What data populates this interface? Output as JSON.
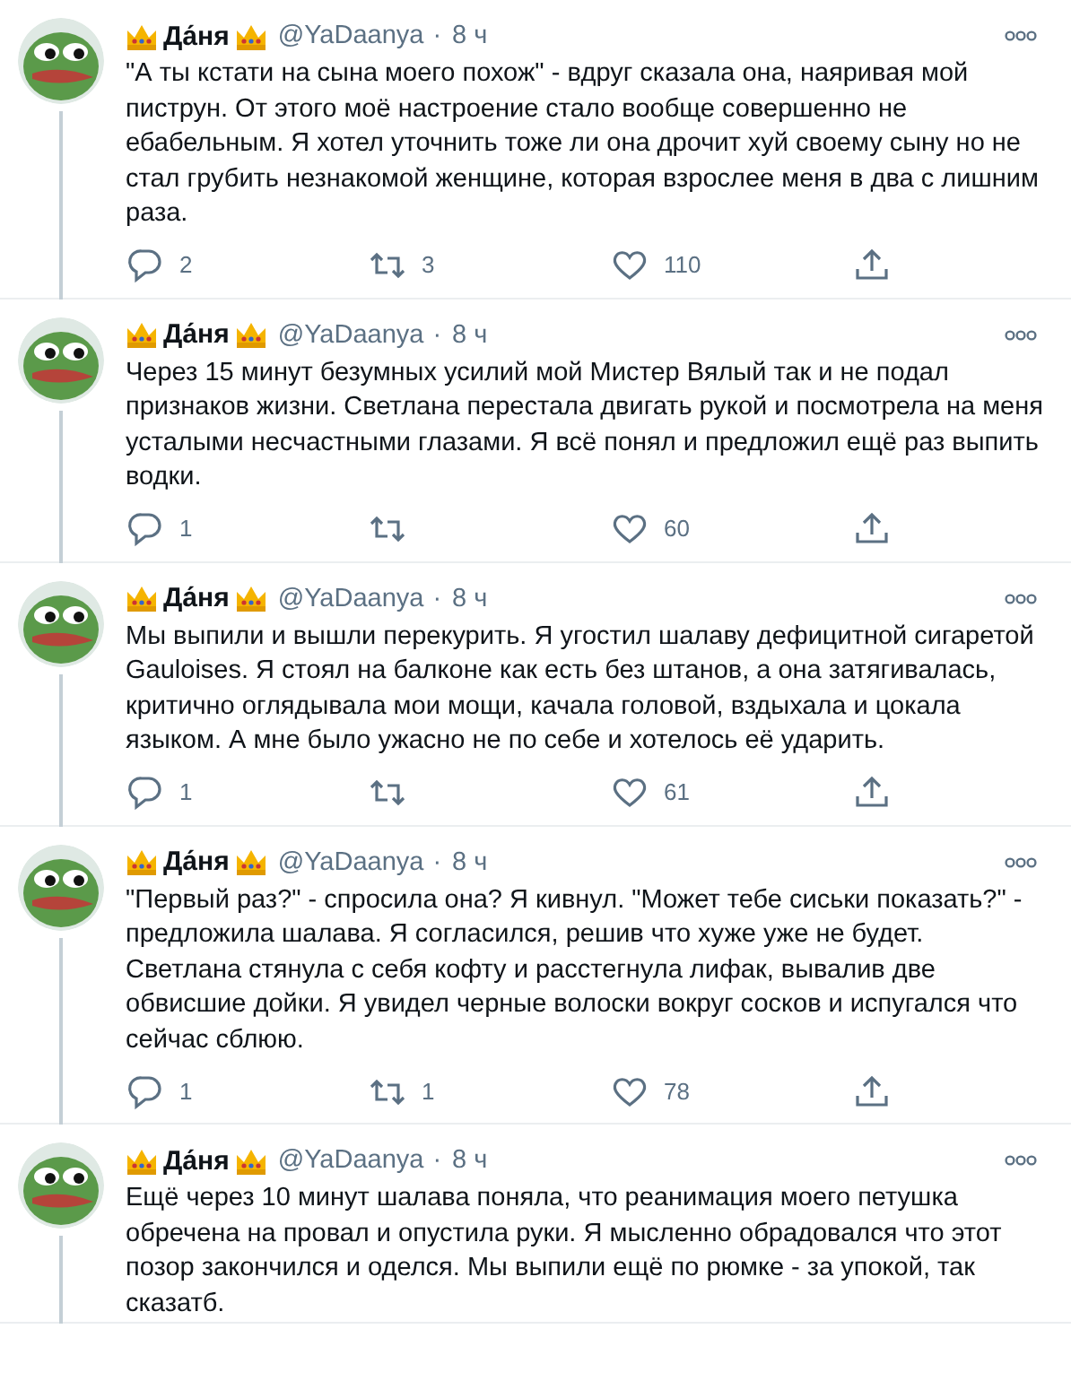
{
  "tweets": [
    {
      "name": "Да́ня",
      "handle": "@YaDaanya",
      "separator": "·",
      "time": "8 ч",
      "text": "\"А ты кстати на сына моего похож\" - вдруг сказала она, наяривая мой пиструн. От этого моё настроение стало вообще совершенно не ебабельным. Я хотел уточнить тоже ли она дрочит хуй своему сыну но не стал грубить незнакомой женщине, которая взрослее меня в два с лишним раза.",
      "actions": [
        {
          "kind": "reply",
          "count": "2"
        },
        {
          "kind": "retweet",
          "count": "3"
        },
        {
          "kind": "like",
          "count": "110"
        },
        {
          "kind": "share"
        }
      ]
    },
    {
      "name": "Да́ня",
      "handle": "@YaDaanya",
      "separator": "·",
      "time": "8 ч",
      "text": "Через 15 минут безумных усилий мой Мистер Вялый так и не подал признаков жизни. Светлана перестала двигать рукой и посмотрела на меня усталыми несчастными глазами. Я всё понял и предложил ещё раз выпить водки.",
      "actions": [
        {
          "kind": "reply",
          "count": "1"
        },
        {
          "kind": "retweet"
        },
        {
          "kind": "like",
          "count": "60"
        },
        {
          "kind": "share"
        }
      ]
    },
    {
      "name": "Да́ня",
      "handle": "@YaDaanya",
      "separator": "·",
      "time": "8 ч",
      "text": "Мы выпили и вышли перекурить. Я угостил шалаву дефицитной сигаретой Gauloises. Я стоял на балконе как есть без штанов, а она затягивалась, критично оглядывала мои мощи, качала головой, вздыхала и цокала языком. А мне было ужасно не по себе и хотелось её ударить.",
      "actions": [
        {
          "kind": "reply",
          "count": "1"
        },
        {
          "kind": "retweet"
        },
        {
          "kind": "like",
          "count": "61"
        },
        {
          "kind": "share"
        }
      ]
    },
    {
      "name": "Да́ня",
      "handle": "@YaDaanya",
      "separator": "·",
      "time": "8 ч",
      "text": "\"Первый раз?\" - спросила она? Я кивнул. \"Может тебе сиськи показать?\" - предложила шалава. Я согласился, решив что хуже уже не будет. Светлана стянула с себя кофту и расстегнула лифак, вывалив две обвисшие дойки. Я увидел черные волоски вокруг сосков и испугался что сейчас сблюю.",
      "actions": [
        {
          "kind": "reply",
          "count": "1"
        },
        {
          "kind": "retweet",
          "count": "1"
        },
        {
          "kind": "like",
          "count": "78"
        },
        {
          "kind": "share"
        }
      ]
    },
    {
      "name": "Да́ня",
      "handle": "@YaDaanya",
      "separator": "·",
      "time": "8 ч",
      "text": "Ещё через 10 минут шалава поняла, что реанимация моего петушка обречена на провал и опустила руки. Я мысленно обрадовался что этот позор закончился и оделся. Мы выпили ещё по рюмке - за упокой, так сказатб."
    }
  ]
}
